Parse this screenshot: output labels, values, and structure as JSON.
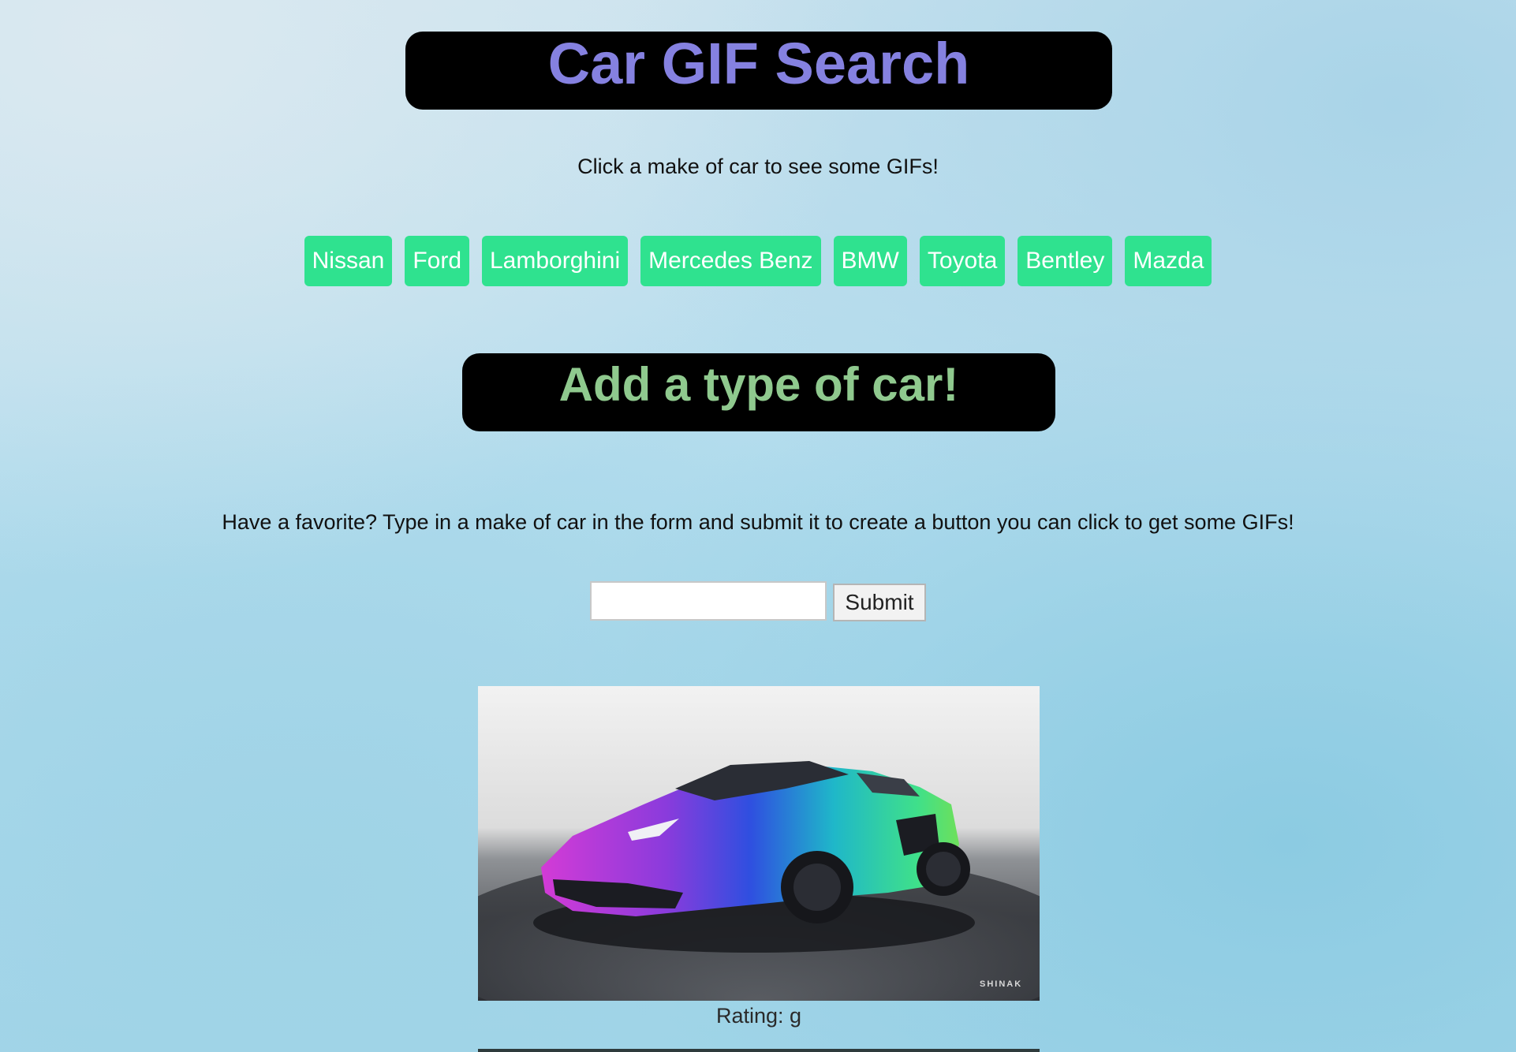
{
  "header": {
    "title": "Car GIF Search",
    "subtitle": "Click a make of car to see some GIFs!",
    "title_color": "#8581e0"
  },
  "car_buttons": [
    {
      "label": "Nissan"
    },
    {
      "label": "Ford"
    },
    {
      "label": "Lamborghini"
    },
    {
      "label": "Mercedes Benz"
    },
    {
      "label": "BMW"
    },
    {
      "label": "Toyota"
    },
    {
      "label": "Bentley"
    },
    {
      "label": "Mazda"
    }
  ],
  "button_color": "#2fe28f",
  "add_section": {
    "heading": "Add a type of car!",
    "heading_color": "#8fc98e",
    "instructions": "Have a favorite? Type in a make of car in the form and submit it to create a button you can click to get some GIFs!",
    "input_value": "",
    "submit_label": "Submit"
  },
  "gifs": [
    {
      "rating": "Rating: g",
      "watermark": "SHINAK",
      "image_icon": "rainbow-sports-car-image"
    }
  ]
}
